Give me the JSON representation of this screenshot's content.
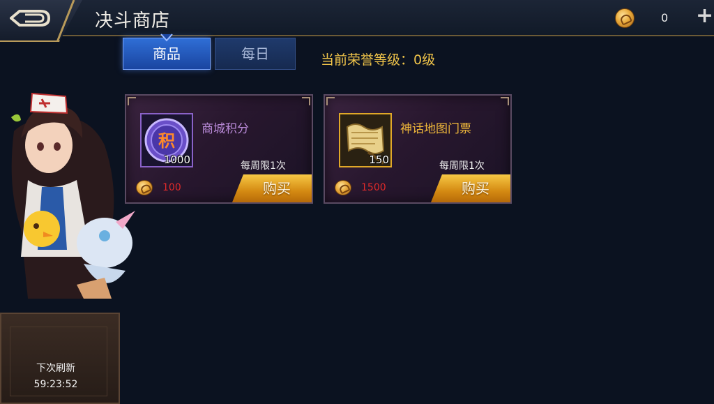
{
  "header": {
    "title": "决斗商店",
    "currency_amount": "0",
    "add_label": "+"
  },
  "tabs": [
    {
      "label": "商品",
      "active": true
    },
    {
      "label": "每日",
      "active": false
    }
  ],
  "honor_level": "当前荣誉等级：0级",
  "items": [
    {
      "name": "商城积分",
      "icon": "mall-points-icon",
      "icon_text": "积",
      "count": "1000",
      "limit": "每周限1次",
      "price": "100",
      "buy_label": "购买"
    },
    {
      "name": "神话地图门票",
      "icon": "map-scroll-icon",
      "count": "150",
      "limit": "每周限1次",
      "price": "1500",
      "buy_label": "购买"
    }
  ],
  "refresh": {
    "label": "下次刷新",
    "time": "59:23:52"
  },
  "colors": {
    "accent_gold": "#f0c44a",
    "price_red": "#e02a2a",
    "tab_active": "#2f6ed6"
  }
}
